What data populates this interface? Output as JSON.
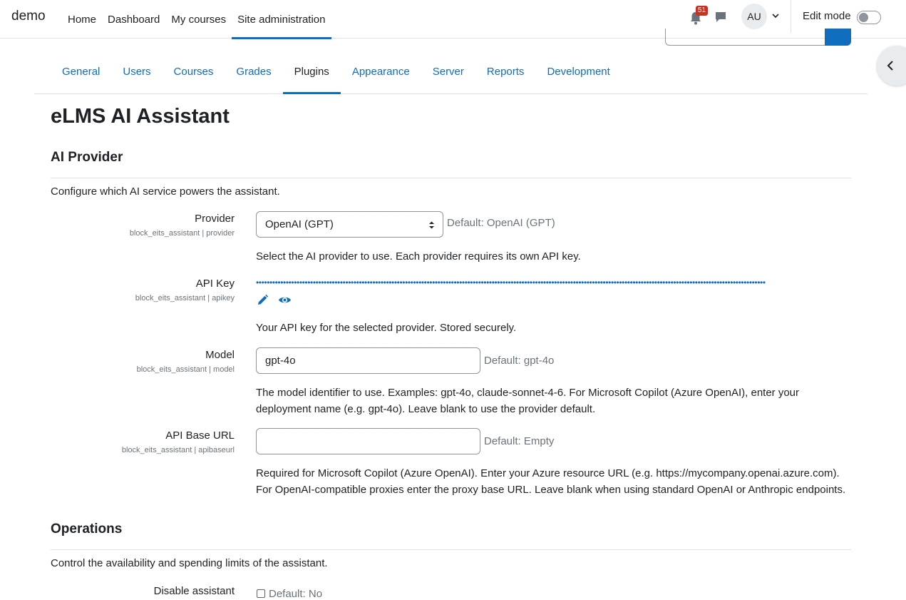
{
  "navbar": {
    "brand": "demo",
    "items": [
      "Home",
      "Dashboard",
      "My courses",
      "Site administration"
    ],
    "notification_count": "51",
    "avatar_initials": "AU",
    "edit_mode_label": "Edit mode"
  },
  "tabs": [
    "General",
    "Users",
    "Courses",
    "Grades",
    "Plugins",
    "Appearance",
    "Server",
    "Reports",
    "Development"
  ],
  "page_title": "eLMS AI Assistant",
  "sections": {
    "ai_provider": {
      "heading": "AI Provider",
      "description": "Configure which AI service powers the assistant.",
      "provider": {
        "label": "Provider",
        "key": "block_eits_assistant | provider",
        "value": "OpenAI (GPT)",
        "default": "Default: OpenAI (GPT)",
        "help": "Select the AI provider to use. Each provider requires its own API key."
      },
      "apikey": {
        "label": "API Key",
        "key": "block_eits_assistant | apikey",
        "masked": "••••••••••••••••••••••••••••••••••••••••••••••••••••••••••••••••••••••••••••••••••••••••••••••••••••••••••••••••••••••••••••••••••••••••••••••••••••••••••••••••••••••••••••••••••••••••••••",
        "help": "Your API key for the selected provider. Stored securely."
      },
      "model": {
        "label": "Model",
        "key": "block_eits_assistant | model",
        "value": "gpt-4o",
        "default": "Default: gpt-4o",
        "help_line1": "The model identifier to use. Examples: gpt-4o, claude-sonnet-4-6. For Microsoft Copilot (Azure OpenAI), enter your",
        "help_line2": "deployment name (e.g. gpt-4o). Leave blank to use the provider default."
      },
      "apibaseurl": {
        "label": "API Base URL",
        "key": "block_eits_assistant | apibaseurl",
        "value": "",
        "default": "Default: Empty",
        "help_line1": "Required for Microsoft Copilot (Azure OpenAI). Enter your Azure resource URL (e.g. https://mycompany.openai.azure.com).",
        "help_line2": "For OpenAI-compatible proxies enter the proxy base URL. Leave blank when using standard OpenAI or Anthropic endpoints."
      }
    },
    "operations": {
      "heading": "Operations",
      "description": "Control the availability and spending limits of the assistant.",
      "disable": {
        "label": "Disable assistant",
        "default": "Default: No"
      }
    }
  }
}
